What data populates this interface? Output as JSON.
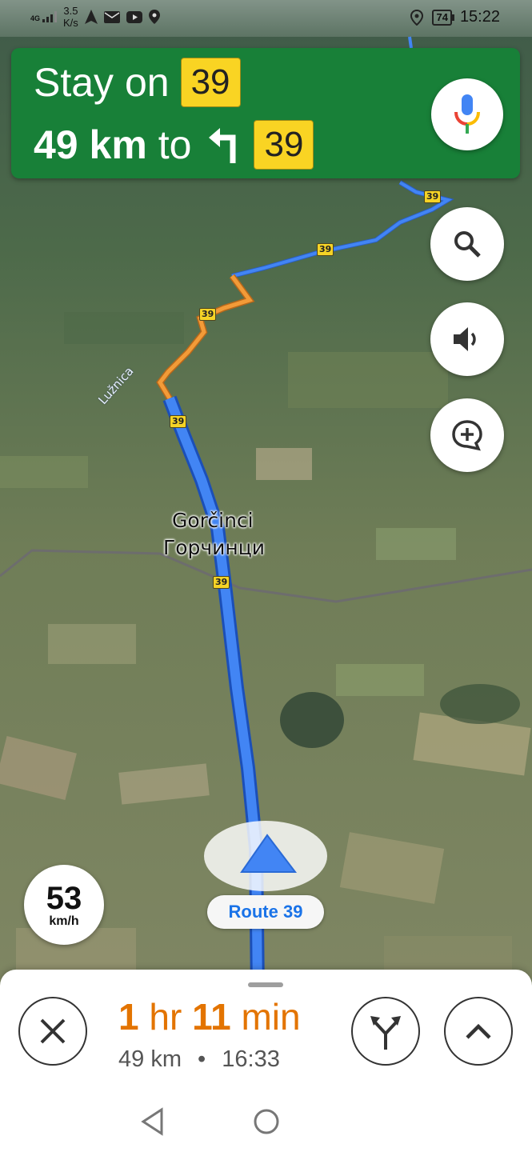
{
  "status_bar": {
    "network_type": "4G",
    "data_speed_value": "3.5",
    "data_speed_unit": "K/s",
    "time": "15:22",
    "battery_level": "74"
  },
  "navigation": {
    "instruction": "Stay on",
    "route_shield": "39",
    "distance": "49 km",
    "distance_suffix": "to",
    "next_turn_shield": "39"
  },
  "map": {
    "place_name_latin": "Gorčinci",
    "place_name_cyrillic": "Горчинци",
    "river_label": "Lužnica",
    "road_shields": [
      "39",
      "39",
      "39",
      "39",
      "39"
    ],
    "colors": {
      "route_active": "#4285f4",
      "route_slow": "#f29b38"
    }
  },
  "controls": {
    "search_icon": "search-icon",
    "sound_icon": "volume-icon",
    "report_icon": "add-comment-icon"
  },
  "speed": {
    "value": "53",
    "unit": "km/h"
  },
  "route_chip": {
    "label": "Route 39"
  },
  "trip": {
    "eta_hours_num": "1",
    "eta_hours_unit": "hr",
    "eta_minutes_num": "11",
    "eta_minutes_unit": "min",
    "remaining_distance": "49 km",
    "separator": "•",
    "arrival_time": "16:33"
  },
  "theme": {
    "banner_green": "#188038",
    "eta_orange": "#e37400",
    "accent_blue": "#1a73e8",
    "shield_yellow": "#f9d423"
  }
}
